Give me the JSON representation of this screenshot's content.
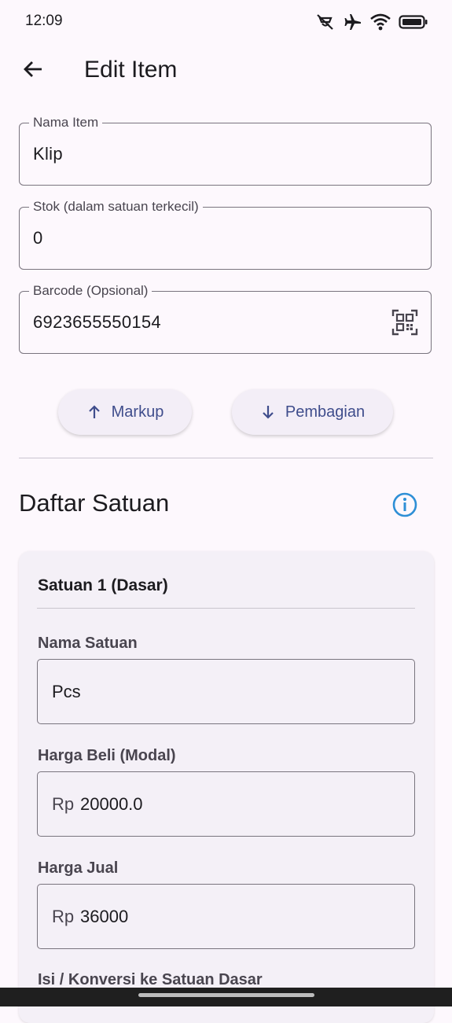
{
  "status_bar": {
    "time": "12:09",
    "icons": [
      "mute-vibrate-icon",
      "airplane-icon",
      "wifi-icon",
      "battery-icon"
    ]
  },
  "app_bar": {
    "back_icon": "arrow-back-icon",
    "title": "Edit Item"
  },
  "form": {
    "nama_item": {
      "label": "Nama Item",
      "value": "Klip"
    },
    "stok": {
      "label": "Stok (dalam satuan terkecil)",
      "value": "0"
    },
    "barcode": {
      "label": "Barcode (Opsional)",
      "value": "6923655550154",
      "icon": "qr-scan-icon"
    }
  },
  "actions": {
    "markup_label": "Markup",
    "markup_icon": "arrow-up-icon",
    "pembagian_label": "Pembagian",
    "pembagian_icon": "arrow-down-icon"
  },
  "units_section": {
    "title": "Daftar Satuan",
    "info_icon": "info-icon",
    "units": [
      {
        "title": "Satuan 1 (Dasar)",
        "nama_label": "Nama Satuan",
        "nama_value": "Pcs",
        "beli_label": "Harga Beli (Modal)",
        "beli_prefix": "Rp",
        "beli_value": "20000.0",
        "jual_label": "Harga Jual",
        "jual_prefix": "Rp",
        "jual_value": "36000",
        "konversi_label": "Isi / Konversi ke Satuan Dasar"
      }
    ]
  },
  "colors": {
    "background": "#fdf8fd",
    "accent": "#3f4d8c",
    "info_icon": "#2e8fd6",
    "outline": "#79747e"
  }
}
